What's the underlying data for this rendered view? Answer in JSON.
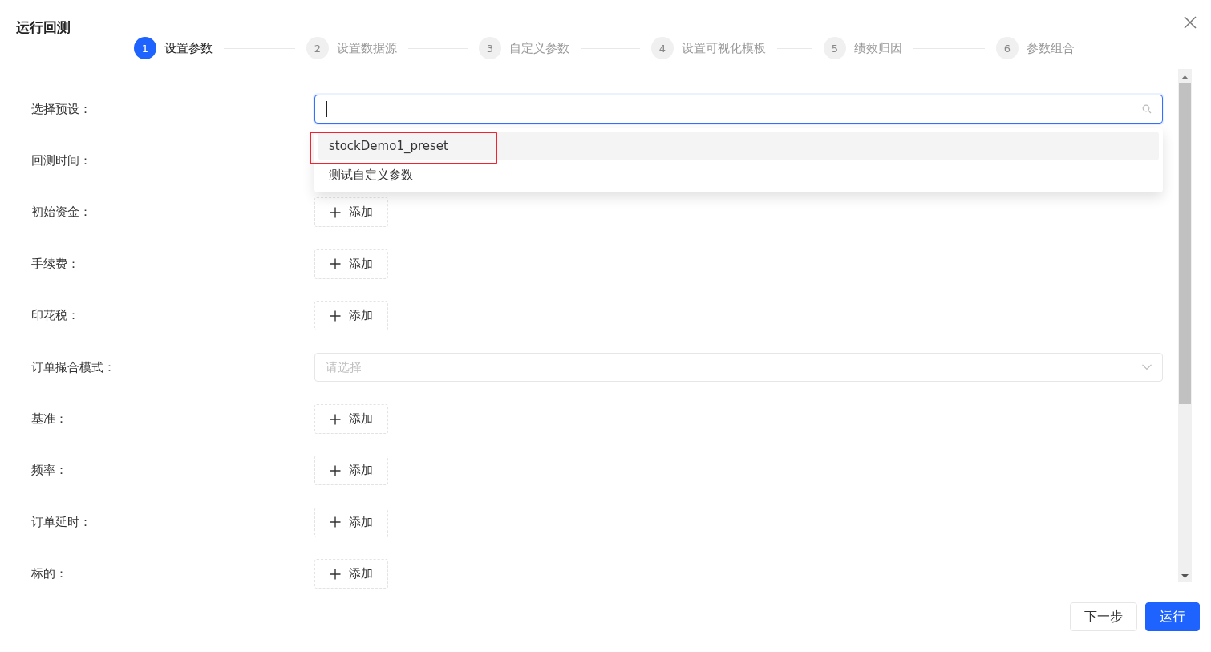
{
  "dialog": {
    "title": "运行回测"
  },
  "steps": [
    {
      "number": "1",
      "label": "设置参数",
      "selected": true
    },
    {
      "number": "2",
      "label": "设置数据源",
      "selected": false
    },
    {
      "number": "3",
      "label": "自定义参数",
      "selected": false
    },
    {
      "number": "4",
      "label": "设置可视化模板",
      "selected": false
    },
    {
      "number": "5",
      "label": "绩效归因",
      "selected": false
    },
    {
      "number": "6",
      "label": "参数组合",
      "selected": false
    }
  ],
  "form": [
    {
      "label": "选择预设：",
      "kind": "search",
      "focused": true
    },
    {
      "label": "回测时间：",
      "kind": "hidden"
    },
    {
      "label": "初始资金：",
      "kind": "add",
      "button": "添加"
    },
    {
      "label": "手续费：",
      "kind": "add",
      "button": "添加"
    },
    {
      "label": "印花税：",
      "kind": "add",
      "button": "添加"
    },
    {
      "label": "订单撮合模式：",
      "kind": "select",
      "placeholder": "请选择"
    },
    {
      "label": "基准：",
      "kind": "add",
      "button": "添加"
    },
    {
      "label": "频率：",
      "kind": "add",
      "button": "添加"
    },
    {
      "label": "订单延时：",
      "kind": "add",
      "button": "添加"
    },
    {
      "label": "标的：",
      "kind": "add",
      "button": "添加"
    }
  ],
  "dropdown": {
    "options": [
      {
        "label": "stockDemo1_preset",
        "active": true,
        "annotated": true
      },
      {
        "label": "测试自定义参数",
        "active": false,
        "annotated": false
      }
    ]
  },
  "footer": {
    "buttons": [
      {
        "label": "下一步",
        "kind": "default"
      },
      {
        "label": "运行",
        "kind": "primary"
      }
    ]
  }
}
